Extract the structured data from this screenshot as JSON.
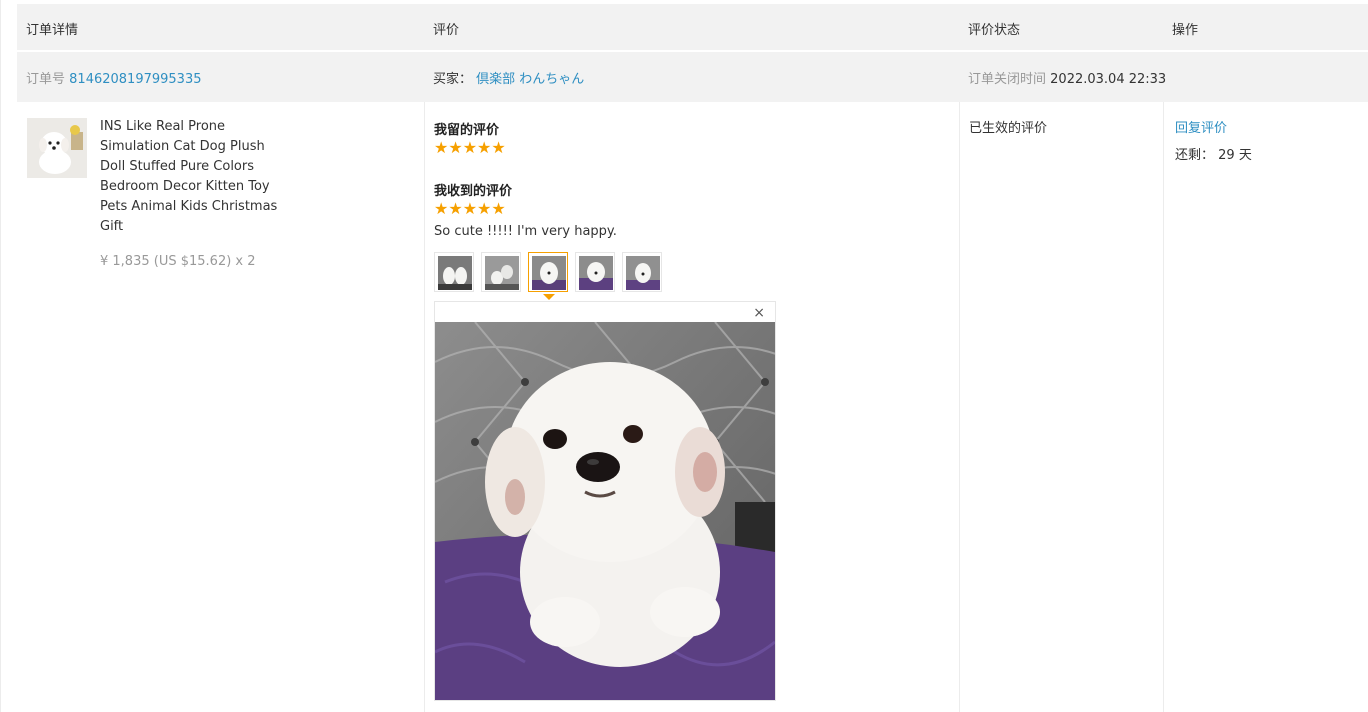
{
  "header": {
    "col_order": "订单详情",
    "col_review": "评价",
    "col_status": "评价状态",
    "col_action": "操作"
  },
  "order_info": {
    "order_no_label": "订单号",
    "order_no": "8146208197995335",
    "buyer_label": "买家：",
    "buyer_name": "倶楽部 わんちゃん",
    "closed_label": "订单关闭时间",
    "closed_time": "2022.03.04 22:33"
  },
  "product": {
    "title": "INS Like Real Prone Simulation Cat Dog Plush Doll Stuffed Pure Colors Bedroom Decor Kitten Toy Pets Animal Kids Christmas Gift",
    "price": "¥ 1,835 (US $15.62) x 2"
  },
  "review": {
    "my_review_label": "我留的评价",
    "my_stars": "★★★★★",
    "received_label": "我收到的评价",
    "received_stars": "★★★★★",
    "received_text": "So cute !!!!! I'm very happy.",
    "close_glyph": "×",
    "selected_photo": 3,
    "photo_count": 5
  },
  "status": {
    "text": "已生效的评价"
  },
  "actions": {
    "reply_label": "回复评价",
    "remaining_label": "还剩：",
    "remaining_value": "29 天"
  },
  "colors": {
    "accent_link": "#2f8fc2",
    "star": "#f6a000",
    "header_bg": "#f2f2f2"
  }
}
